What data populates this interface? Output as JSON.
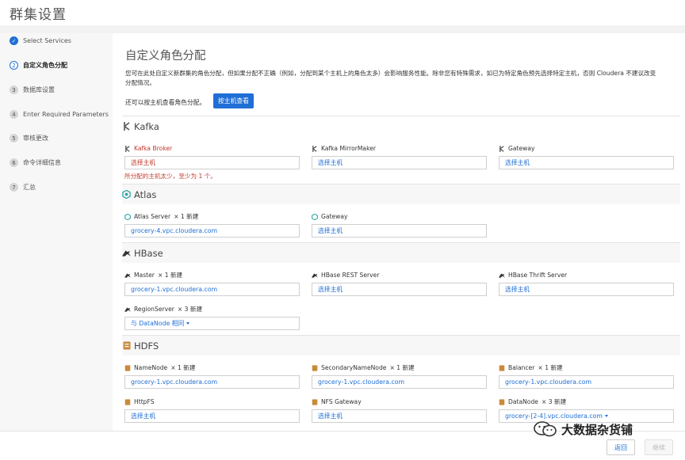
{
  "page_title": "群集设置",
  "steps": [
    {
      "num": "✓",
      "label": "Select Services",
      "state": "done"
    },
    {
      "num": "2",
      "label": "自定义角色分配",
      "state": "current"
    },
    {
      "num": "3",
      "label": "数据库设置",
      "state": "pending"
    },
    {
      "num": "4",
      "label": "Enter Required Parameters",
      "state": "pending"
    },
    {
      "num": "5",
      "label": "审核更改",
      "state": "pending"
    },
    {
      "num": "6",
      "label": "命令详细信息",
      "state": "pending"
    },
    {
      "num": "7",
      "label": "汇总",
      "state": "pending"
    }
  ],
  "main": {
    "title": "自定义角色分配",
    "description": "您可在此处自定义新群集的角色分配，但如果分配不正确（例如，分配到某个主机上的角色太多）会影响服务性能。除非您有特殊需求，如已为特定角色预先选择特定主机，否则 Cloudera 不建议改变分配情况。",
    "host_line": "还可以按主机查看角色分配。",
    "host_button": "按主机查看"
  },
  "sections": {
    "kafka": {
      "name": "Kafka",
      "roles": [
        {
          "name": "Kafka Broker",
          "value": "选择主机",
          "error": "所分配的主机太少，至少为 1 个。"
        },
        {
          "name": "Kafka MirrorMaker",
          "value": "选择主机"
        },
        {
          "name": "Gateway",
          "value": "选择主机"
        }
      ]
    },
    "atlas": {
      "name": "Atlas",
      "roles": [
        {
          "name": "Atlas Server",
          "count": "× 1 新建",
          "value": "grocery-4.vpc.cloudera.com"
        },
        {
          "name": "Gateway",
          "value": "选择主机"
        }
      ]
    },
    "hbase": {
      "name": "HBase",
      "roles": [
        {
          "name": "Master",
          "count": "× 1 新建",
          "value": "grocery-1.vpc.cloudera.com"
        },
        {
          "name": "HBase REST Server",
          "value": "选择主机"
        },
        {
          "name": "HBase Thrift Server",
          "value": "选择主机"
        },
        {
          "name": "RegionServer",
          "count": "× 3 新建",
          "value": "与 DataNode 相同"
        }
      ]
    },
    "hdfs": {
      "name": "HDFS",
      "roles": [
        {
          "name": "NameNode",
          "count": "× 1 新建",
          "value": "grocery-1.vpc.cloudera.com"
        },
        {
          "name": "SecondaryNameNode",
          "count": "× 1 新建",
          "value": "grocery-1.vpc.cloudera.com"
        },
        {
          "name": "Balancer",
          "count": "× 1 新建",
          "value": "grocery-1.vpc.cloudera.com"
        },
        {
          "name": "HttpFS",
          "value": "选择主机"
        },
        {
          "name": "NFS Gateway",
          "value": "选择主机"
        },
        {
          "name": "DataNode",
          "count": "× 3 新建",
          "value": "grocery-[2-4].vpc.cloudera.com"
        }
      ]
    }
  },
  "footer": {
    "back": "返回",
    "continue": "继续"
  },
  "watermark": "大数据杂货铺",
  "colors": {
    "accent": "#1f6fd6",
    "error": "#c0392b",
    "sidebar_bg": "#f7f7f7"
  }
}
